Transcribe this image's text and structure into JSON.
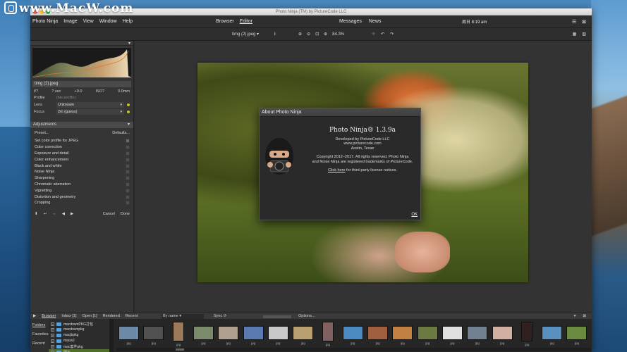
{
  "watermark": "www.MacW.com",
  "window": {
    "title": "Photo Ninja (TM) by PictureCode LLC"
  },
  "menu": {
    "items": [
      "Photo Ninja",
      "Image",
      "View",
      "Window",
      "Help"
    ],
    "modes": [
      "Browser",
      "Editor"
    ],
    "active_mode": "Editor",
    "links": [
      "Messages",
      "News"
    ],
    "clock": "周日 8:19 am"
  },
  "toolbar": {
    "filename": "timg (2).jpeg",
    "info_icon": "i",
    "zoom": "84.3%"
  },
  "left": {
    "file_label": "timg (2).jpeg",
    "exif": [
      "f/?",
      "? sec",
      "+0.0",
      "ISO?",
      "0.0mm"
    ],
    "profile_label": "Profile",
    "profile_value": "(No profile)",
    "lens_label": "Lens",
    "lens_value": "Unknown",
    "focus_label": "Focus",
    "focus_value": "2m (guess)",
    "adjustments_title": "Adjustments",
    "preset_label": "Preset...",
    "defaults_label": "Defaults...",
    "adjustments": [
      {
        "label": "Set color profile for JPEG",
        "on": true
      },
      {
        "label": "Color correction",
        "on": false
      },
      {
        "label": "Exposure and detail",
        "on": false
      },
      {
        "label": "Color enhancement",
        "on": false
      },
      {
        "label": "Black and white",
        "on": false
      },
      {
        "label": "Noise Ninja",
        "on": false
      },
      {
        "label": "Sharpening",
        "on": false
      },
      {
        "label": "Chromatic aberration",
        "on": false
      },
      {
        "label": "Vignetting",
        "on": false
      },
      {
        "label": "Distortion and geometry",
        "on": false
      },
      {
        "label": "Cropping",
        "on": false
      }
    ],
    "cancel": "Cancel",
    "done": "Done"
  },
  "about": {
    "title": "About Photo Ninja",
    "app_name": "Photo Ninja® 1.3.9a",
    "developer": [
      "Developed by PictureCode LLC",
      "www.picturecode.com",
      "Austin, Texas"
    ],
    "copyright": [
      "Copyright 2012–2017. All rights reserved. Photo Ninja",
      "and Noise Ninja are registered trademarks of PictureCode."
    ],
    "link_text": "Click here",
    "link_suffix": " for third-party license notices.",
    "ok": "OK"
  },
  "browser": {
    "tabs": [
      "Browser",
      "Inbox [1]",
      "Open [1]",
      "Rendered",
      "Recent"
    ],
    "active_tab": "Browser",
    "sort": "By name",
    "sync": "Sync",
    "options": "Options...",
    "side": [
      "Folders",
      "Favorites",
      "Recent"
    ],
    "folders": [
      "macdownPKG打包",
      "macdownpkg",
      "macjbpkg",
      "macw2",
      "mac套件pkg",
      "图片"
    ],
    "selected_folder": "图片",
    "thumb_ext": "jpg",
    "thumb_colors": [
      "#6a8aa8",
      "#505050",
      "#9a7a5a",
      "#7a8a6a",
      "#b0a090",
      "#5a7ab0",
      "#c8c8c8",
      "#b8a070",
      "#806060",
      "#4a8ac0",
      "#a06040",
      "#c08040",
      "#6a7a40",
      "#e0e0e0",
      "#708090",
      "#d0b0a0",
      "#302020",
      "#5a90c0",
      "#6a8a40"
    ],
    "thumb_tall": [
      false,
      false,
      true,
      false,
      false,
      false,
      false,
      false,
      true,
      false,
      false,
      false,
      false,
      false,
      false,
      false,
      true,
      false,
      false
    ]
  }
}
